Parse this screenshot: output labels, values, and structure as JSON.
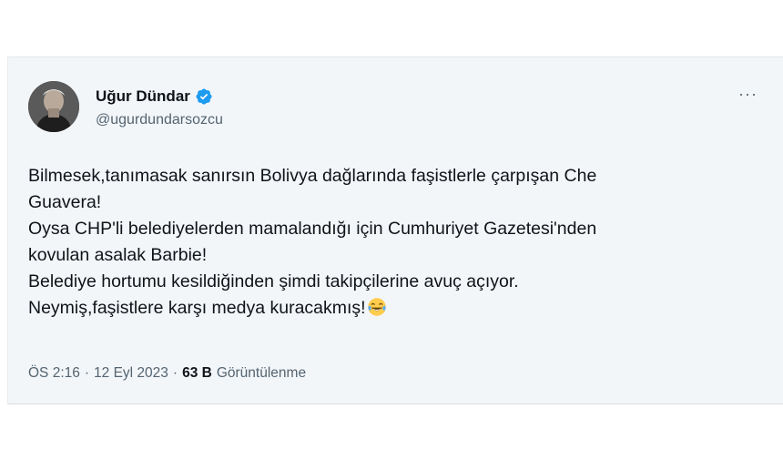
{
  "author": {
    "display_name": "Uğur Dündar",
    "handle": "@ugurdundarsozcu",
    "verified": true
  },
  "menu": {
    "more_label": "···"
  },
  "tweet": {
    "lines": [
      "Bilmesek,tanımasak sanırsın Bolivya dağlarında faşistlerle çarpışan Che",
      "Guavera!",
      "Oysa CHP'li belediyelerden mamalandığı için Cumhuriyet Gazetesi'nden",
      "kovulan asalak Barbie!",
      "Belediye hortumu kesildiğinden şimdi takipçilerine avuç açıyor.",
      "Neymiş,faşistlere karşı medya kuracakmış!"
    ],
    "emoji": "face-with-tears-of-joy"
  },
  "meta": {
    "time": "ÖS 2:16",
    "separator1": "·",
    "date": "12 Eyl 2023",
    "separator2": "·",
    "views_count": "63 B",
    "views_label": "Görüntülenme"
  },
  "colors": {
    "card_bg": "#f3f6f9",
    "text": "#0f1419",
    "muted": "#536471",
    "verified": "#1d9bf0"
  }
}
